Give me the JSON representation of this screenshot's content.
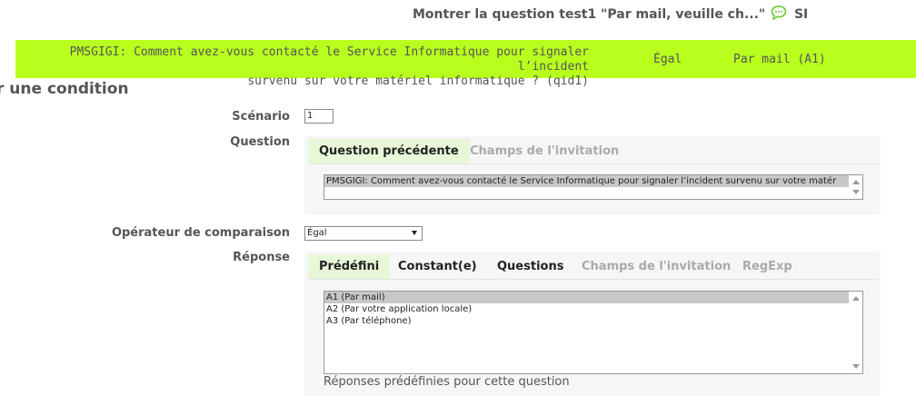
{
  "header": {
    "title_text": "Montrer la question test1 \"Par mail, veuille ch...\"",
    "title_suffix": "SI",
    "chat_icon": "speech-bubble-icon",
    "chat_icon_color": "#7ac943"
  },
  "condition_bar": {
    "question_line1": "PMSGIGI: Comment avez-vous contacté le Service Informatique pour signaler l’incident",
    "question_line2": "survenu sur votre matériel informatique ? (qid1)",
    "operator": "Égal",
    "answer": "Par mail (A1)",
    "background": "#b8ff1e"
  },
  "form": {
    "section_title": "r une condition",
    "scenario_label": "Scénario",
    "scenario_value": "1",
    "question_label": "Question",
    "question_tabs": [
      {
        "label": "Question précédente",
        "state": "active"
      },
      {
        "label": "Champs de l'invitation",
        "state": "disabled"
      }
    ],
    "question_list_item": "PMSGIGI: Comment avez-vous contacté le Service Informatique pour signaler l’incident survenu sur votre matér",
    "operator_label": "Opérateur de comparaison",
    "operator_value": "Égal",
    "response_label": "Réponse",
    "response_tabs": [
      {
        "label": "Prédéfini",
        "state": "active"
      },
      {
        "label": "Constant(e)",
        "state": "normal"
      },
      {
        "label": "Questions",
        "state": "normal"
      },
      {
        "label": "Champs de l'invitation",
        "state": "disabled"
      },
      {
        "label": "RegExp",
        "state": "disabled"
      }
    ],
    "answers": [
      {
        "label": "A1 (Par mail)",
        "selected": true
      },
      {
        "label": "A2 (Par votre application locale)",
        "selected": false
      },
      {
        "label": "A3 (Par téléphone)",
        "selected": false
      }
    ],
    "answers_help": "Réponses prédéfinies pour cette question"
  }
}
